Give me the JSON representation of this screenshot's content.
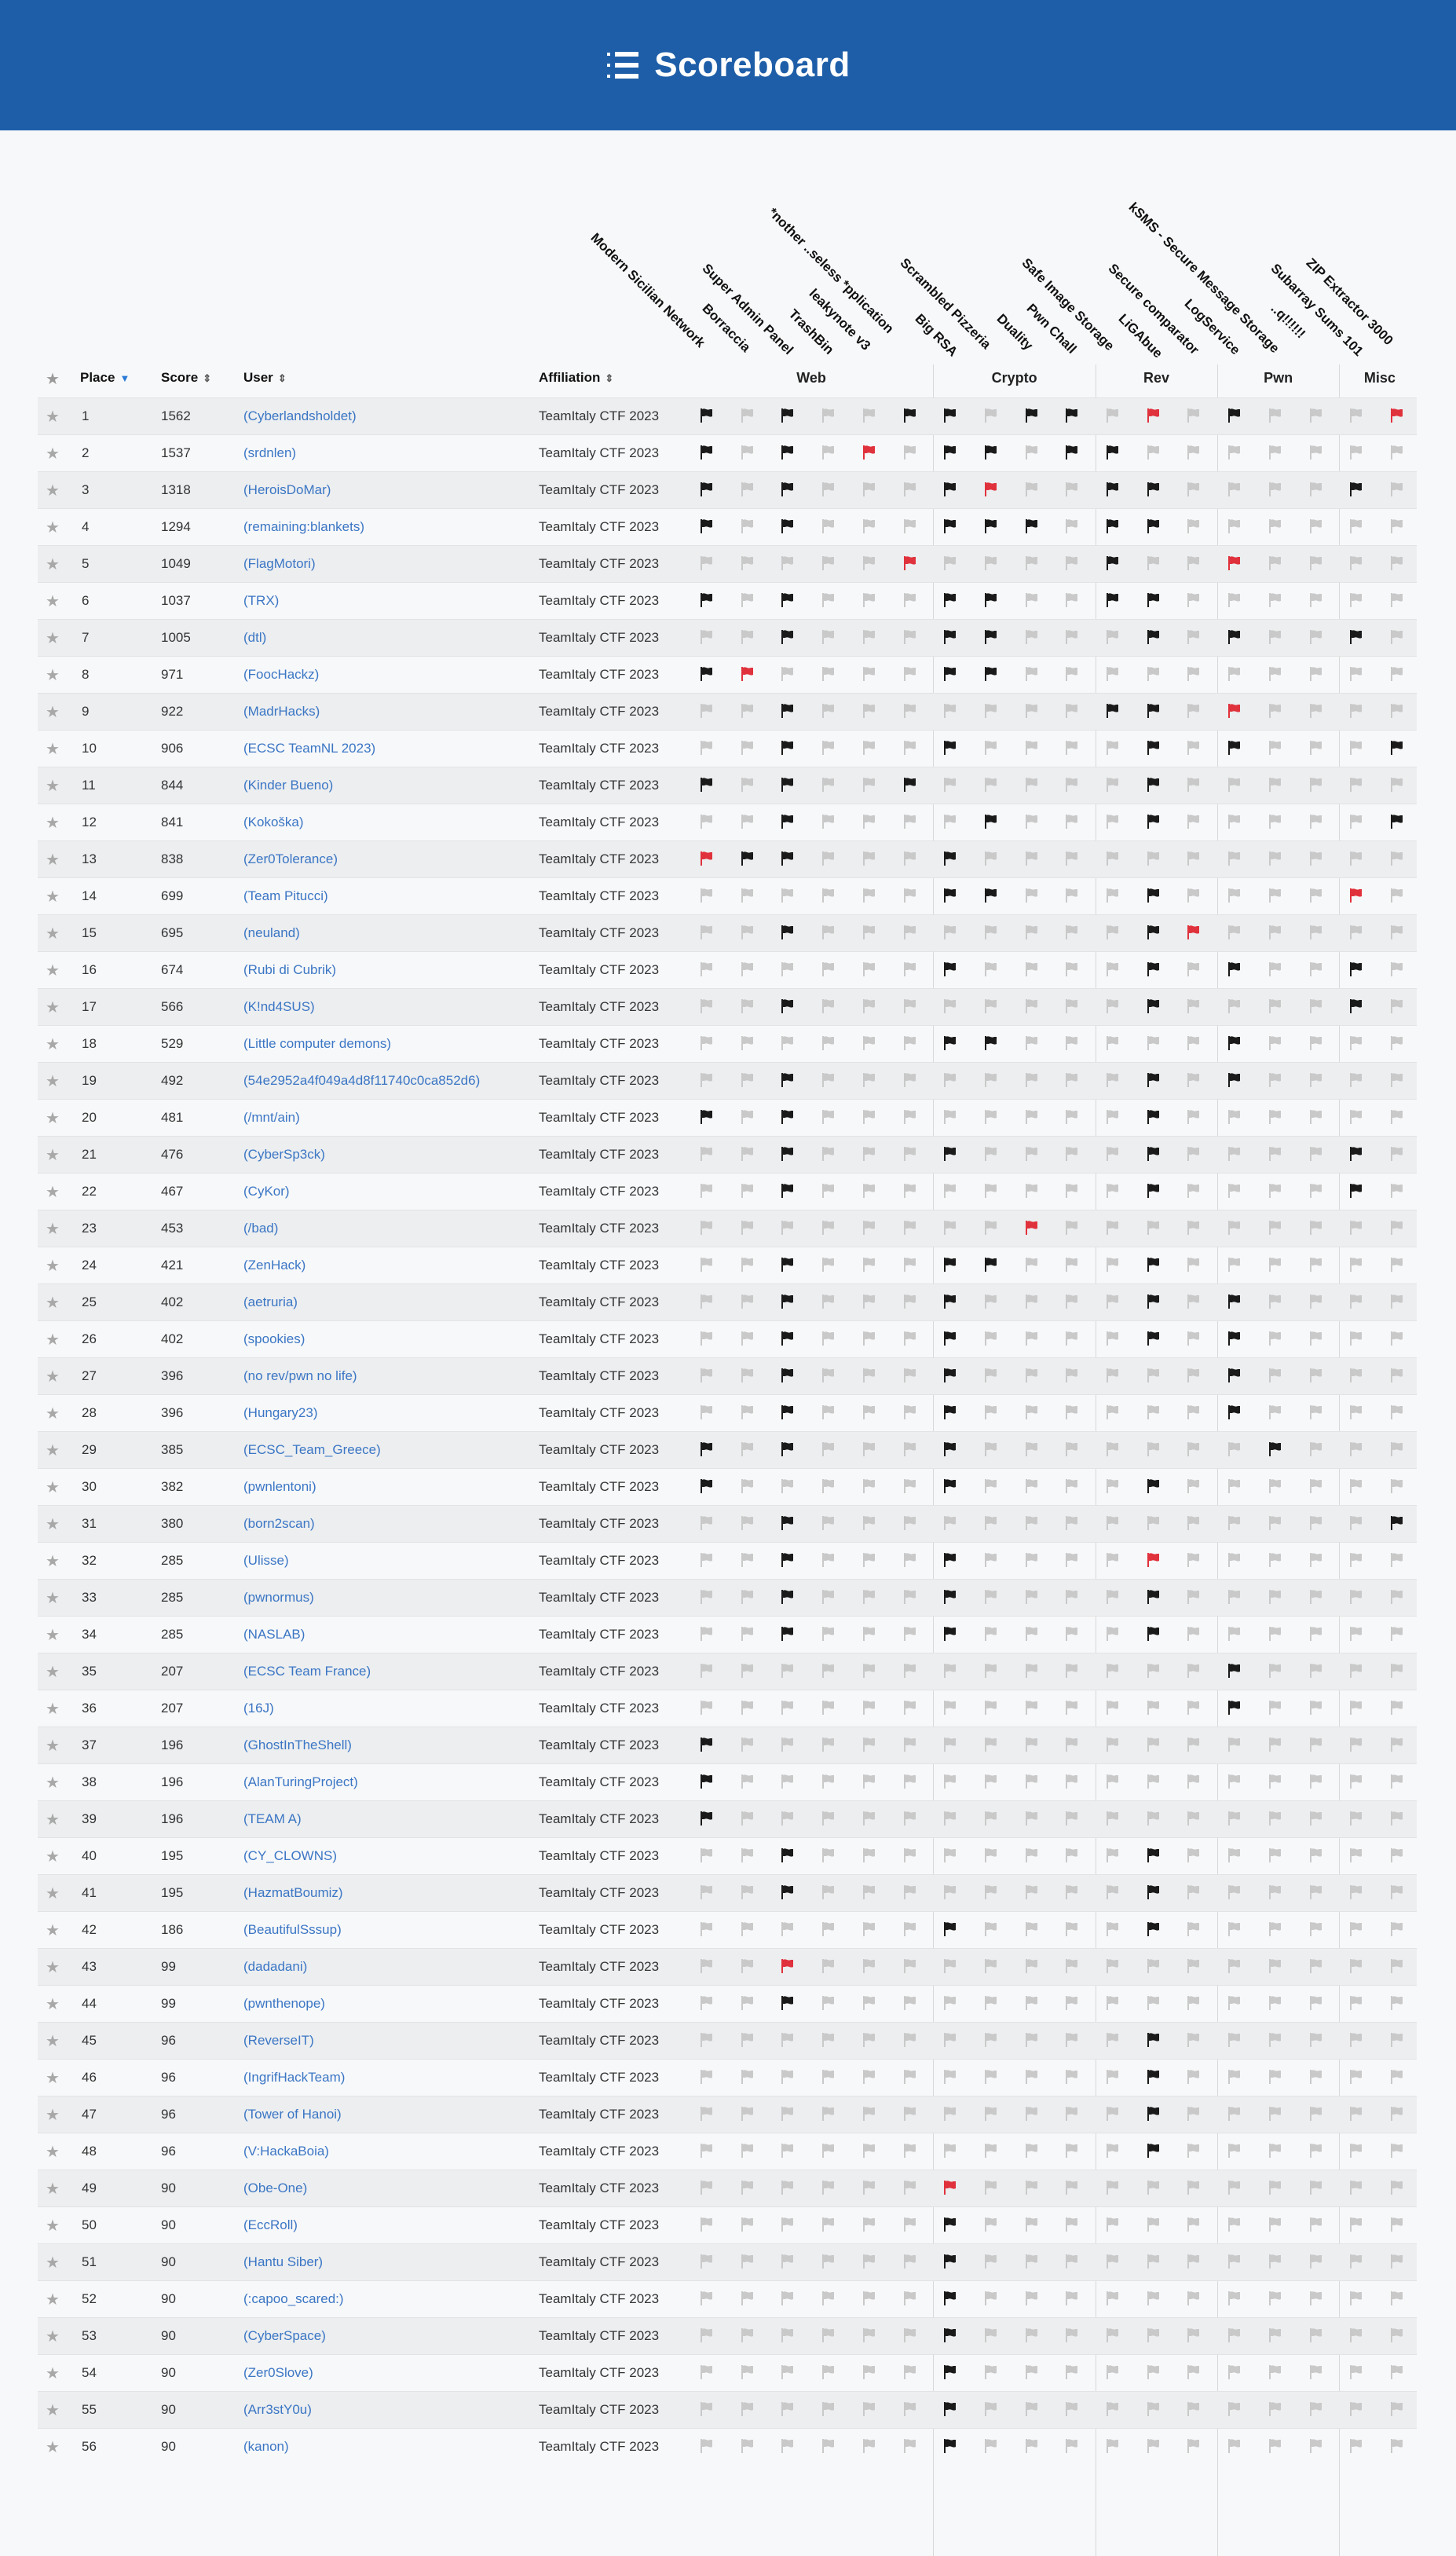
{
  "header": {
    "title": "Scoreboard",
    "logo_icon": "list-icon"
  },
  "columns": {
    "place": "Place",
    "score": "Score",
    "user": "User",
    "affiliation": "Affiliation"
  },
  "categories": [
    {
      "name": "Web",
      "count": 6
    },
    {
      "name": "Crypto",
      "count": 4
    },
    {
      "name": "Rev",
      "count": 3
    },
    {
      "name": "Pwn",
      "count": 3
    },
    {
      "name": "Misc",
      "count": 2
    }
  ],
  "challenges": [
    "Modern Sicilian Network",
    "Borraccia",
    "Super Admin Panel",
    "TrashBin",
    "leakynote v3",
    "*nother ..seless *pplication",
    "Big RSA",
    "Scrambled Pizzeria",
    "Duality",
    "Pwn Chall",
    "Safe Image Storage",
    "LiGAbue",
    "Secure comparator",
    "LogService",
    "kSMS - Secure Message Storage",
    "..q!!!!!!",
    "Subarray Sums 101",
    "ZIP Extractor 3000"
  ],
  "flag_colors": {
    "solved": "#1a1a1a",
    "first_blood": "#e0323c",
    "unsolved": "#c9c9c9"
  },
  "rows": [
    {
      "place": "1",
      "score": "1562",
      "user": "(Cyberlandsholdet)",
      "affiliation": "TeamItaly CTF 2023",
      "flags": "s.s..ss.ss.f.s...f"
    },
    {
      "place": "2",
      "score": "1537",
      "user": "(srdnlen)",
      "affiliation": "TeamItaly CTF 2023",
      "flags": "s.s.f.ss.ss......."
    },
    {
      "place": "3",
      "score": "1318",
      "user": "(HeroisDoMar)",
      "affiliation": "TeamItaly CTF 2023",
      "flags": "s.s...sf..ss....s."
    },
    {
      "place": "4",
      "score": "1294",
      "user": "(remaining:blankets)",
      "affiliation": "TeamItaly CTF 2023",
      "flags": "s.s...sss.ss......"
    },
    {
      "place": "5",
      "score": "1049",
      "user": "(FlagMotori)",
      "affiliation": "TeamItaly CTF 2023",
      "flags": ".....f....s..f...."
    },
    {
      "place": "6",
      "score": "1037",
      "user": "(TRX)",
      "affiliation": "TeamItaly CTF 2023",
      "flags": "s.s...ss..ss......"
    },
    {
      "place": "7",
      "score": "1005",
      "user": "(dtl)",
      "affiliation": "TeamItaly CTF 2023",
      "flags": "..s...ss...s.s..s."
    },
    {
      "place": "8",
      "score": "971",
      "user": "(FoocHackz)",
      "affiliation": "TeamItaly CTF 2023",
      "flags": "sf....ss.........."
    },
    {
      "place": "9",
      "score": "922",
      "user": "(MadrHacks)",
      "affiliation": "TeamItaly CTF 2023",
      "flags": "..s.......ss.f...."
    },
    {
      "place": "10",
      "score": "906",
      "user": "(ECSC TeamNL 2023)",
      "affiliation": "TeamItaly CTF 2023",
      "flags": "..s...s....s.s...s"
    },
    {
      "place": "11",
      "score": "844",
      "user": "(Kinder Bueno)",
      "affiliation": "TeamItaly CTF 2023",
      "flags": "s.s..s.....s......"
    },
    {
      "place": "12",
      "score": "841",
      "user": "(Kokoška)",
      "affiliation": "TeamItaly CTF 2023",
      "flags": "..s....s...s.....s"
    },
    {
      "place": "13",
      "score": "838",
      "user": "(Zer0Tolerance)",
      "affiliation": "TeamItaly CTF 2023",
      "flags": "fss...s..........."
    },
    {
      "place": "14",
      "score": "699",
      "user": "(Team Pitucci)",
      "affiliation": "TeamItaly CTF 2023",
      "flags": "......ss...s....f."
    },
    {
      "place": "15",
      "score": "695",
      "user": "(neuland)",
      "affiliation": "TeamItaly CTF 2023",
      "flags": "..s........sf....."
    },
    {
      "place": "16",
      "score": "674",
      "user": "(Rubi di Cubrik)",
      "affiliation": "TeamItaly CTF 2023",
      "flags": "......s....s.s..s."
    },
    {
      "place": "17",
      "score": "566",
      "user": "(K!nd4SUS)",
      "affiliation": "TeamItaly CTF 2023",
      "flags": "..s........s....s."
    },
    {
      "place": "18",
      "score": "529",
      "user": "(Little computer demons)",
      "affiliation": "TeamItaly CTF 2023",
      "flags": "......ss.....s...."
    },
    {
      "place": "19",
      "score": "492",
      "user": "(54e2952a4f049a4d8f11740c0ca852d6)",
      "affiliation": "TeamItaly CTF 2023",
      "flags": "..s........s.s...."
    },
    {
      "place": "20",
      "score": "481",
      "user": "(/mnt/ain)",
      "affiliation": "TeamItaly CTF 2023",
      "flags": "s.s........s......"
    },
    {
      "place": "21",
      "score": "476",
      "user": "(CyberSp3ck)",
      "affiliation": "TeamItaly CTF 2023",
      "flags": "..s...s....s....s."
    },
    {
      "place": "22",
      "score": "467",
      "user": "(CyKor)",
      "affiliation": "TeamItaly CTF 2023",
      "flags": "..s........s....s."
    },
    {
      "place": "23",
      "score": "453",
      "user": "(/bad)",
      "affiliation": "TeamItaly CTF 2023",
      "flags": "........f........."
    },
    {
      "place": "24",
      "score": "421",
      "user": "(ZenHack)",
      "affiliation": "TeamItaly CTF 2023",
      "flags": "..s...ss...s......"
    },
    {
      "place": "25",
      "score": "402",
      "user": "(aetruria)",
      "affiliation": "TeamItaly CTF 2023",
      "flags": "..s...s....s.s...."
    },
    {
      "place": "26",
      "score": "402",
      "user": "(spookies)",
      "affiliation": "TeamItaly CTF 2023",
      "flags": "..s...s....s.s...."
    },
    {
      "place": "27",
      "score": "396",
      "user": "(no rev/pwn no life)",
      "affiliation": "TeamItaly CTF 2023",
      "flags": "..s...s......s...."
    },
    {
      "place": "28",
      "score": "396",
      "user": "(Hungary23)",
      "affiliation": "TeamItaly CTF 2023",
      "flags": "..s...s......s...."
    },
    {
      "place": "29",
      "score": "385",
      "user": "(ECSC_Team_Greece)",
      "affiliation": "TeamItaly CTF 2023",
      "flags": "s.s...s.......s..."
    },
    {
      "place": "30",
      "score": "382",
      "user": "(pwnlentoni)",
      "affiliation": "TeamItaly CTF 2023",
      "flags": "s.....s....s......"
    },
    {
      "place": "31",
      "score": "380",
      "user": "(born2scan)",
      "affiliation": "TeamItaly CTF 2023",
      "flags": "..s..............s"
    },
    {
      "place": "32",
      "score": "285",
      "user": "(Ulisse)",
      "affiliation": "TeamItaly CTF 2023",
      "flags": "..s...s....f......"
    },
    {
      "place": "33",
      "score": "285",
      "user": "(pwnormus)",
      "affiliation": "TeamItaly CTF 2023",
      "flags": "..s...s....s......"
    },
    {
      "place": "34",
      "score": "285",
      "user": "(NASLAB)",
      "affiliation": "TeamItaly CTF 2023",
      "flags": "..s...s....s......"
    },
    {
      "place": "35",
      "score": "207",
      "user": "(ECSC Team France)",
      "affiliation": "TeamItaly CTF 2023",
      "flags": ".............s...."
    },
    {
      "place": "36",
      "score": "207",
      "user": "(16J)",
      "affiliation": "TeamItaly CTF 2023",
      "flags": ".............s...."
    },
    {
      "place": "37",
      "score": "196",
      "user": "(GhostInTheShell)",
      "affiliation": "TeamItaly CTF 2023",
      "flags": "s................."
    },
    {
      "place": "38",
      "score": "196",
      "user": "(AlanTuringProject)",
      "affiliation": "TeamItaly CTF 2023",
      "flags": "s................."
    },
    {
      "place": "39",
      "score": "196",
      "user": "(TEAM A)",
      "affiliation": "TeamItaly CTF 2023",
      "flags": "s................."
    },
    {
      "place": "40",
      "score": "195",
      "user": "(CY_CLOWNS)",
      "affiliation": "TeamItaly CTF 2023",
      "flags": "..s........s......"
    },
    {
      "place": "41",
      "score": "195",
      "user": "(HazmatBoumiz)",
      "affiliation": "TeamItaly CTF 2023",
      "flags": "..s........s......"
    },
    {
      "place": "42",
      "score": "186",
      "user": "(BeautifulSssup)",
      "affiliation": "TeamItaly CTF 2023",
      "flags": "......s....s......"
    },
    {
      "place": "43",
      "score": "99",
      "user": "(dadadani)",
      "affiliation": "TeamItaly CTF 2023",
      "flags": "..f..............."
    },
    {
      "place": "44",
      "score": "99",
      "user": "(pwnthenope)",
      "affiliation": "TeamItaly CTF 2023",
      "flags": "..s..............."
    },
    {
      "place": "45",
      "score": "96",
      "user": "(ReverseIT)",
      "affiliation": "TeamItaly CTF 2023",
      "flags": "...........s......"
    },
    {
      "place": "46",
      "score": "96",
      "user": "(IngrifHackTeam)",
      "affiliation": "TeamItaly CTF 2023",
      "flags": "...........s......"
    },
    {
      "place": "47",
      "score": "96",
      "user": "(Tower of Hanoi)",
      "affiliation": "TeamItaly CTF 2023",
      "flags": "...........s......"
    },
    {
      "place": "48",
      "score": "96",
      "user": "(V:HackaBoia)",
      "affiliation": "TeamItaly CTF 2023",
      "flags": "...........s......"
    },
    {
      "place": "49",
      "score": "90",
      "user": "(Obe-One)",
      "affiliation": "TeamItaly CTF 2023",
      "flags": "......f..........."
    },
    {
      "place": "50",
      "score": "90",
      "user": "(EccRoll)",
      "affiliation": "TeamItaly CTF 2023",
      "flags": "......s..........."
    },
    {
      "place": "51",
      "score": "90",
      "user": "(Hantu Siber)",
      "affiliation": "TeamItaly CTF 2023",
      "flags": "......s..........."
    },
    {
      "place": "52",
      "score": "90",
      "user": "(:capoo_scared:)",
      "affiliation": "TeamItaly CTF 2023",
      "flags": "......s..........."
    },
    {
      "place": "53",
      "score": "90",
      "user": "(CyberSpace)",
      "affiliation": "TeamItaly CTF 2023",
      "flags": "......s..........."
    },
    {
      "place": "54",
      "score": "90",
      "user": "(Zer0Slove)",
      "affiliation": "TeamItaly CTF 2023",
      "flags": "......s..........."
    },
    {
      "place": "55",
      "score": "90",
      "user": "(Arr3stY0u)",
      "affiliation": "TeamItaly CTF 2023",
      "flags": "......s..........."
    },
    {
      "place": "56",
      "score": "90",
      "user": "(kanon)",
      "affiliation": "TeamItaly CTF 2023",
      "flags": "......s..........."
    }
  ]
}
